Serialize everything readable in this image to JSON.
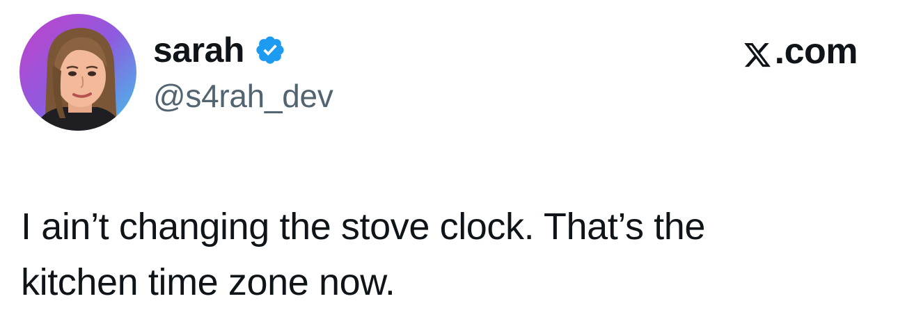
{
  "author": {
    "name": "sarah",
    "handle": "@s4rah_dev",
    "verified": true,
    "avatar": "cartoon-portrait-avatar"
  },
  "site": {
    "logo": "x-logo-icon",
    "suffix": ".com"
  },
  "tweet": {
    "lines": [
      "I ain’t changing the stove clock. That’s the",
      "kitchen time zone now."
    ]
  },
  "colors": {
    "text": "#0f1419",
    "handle": "#536471",
    "verified_badge": "#1d9bf0",
    "avatar_gradient": [
      "#c042c9",
      "#8e5be0",
      "#3fc6ea"
    ]
  }
}
